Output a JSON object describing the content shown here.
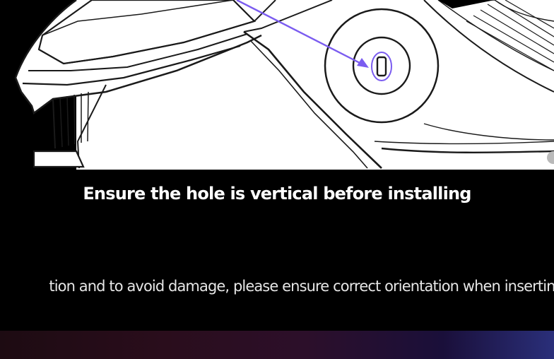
{
  "caption": "Ensure the hole is vertical before installing",
  "description": "tion and to avoid damage, please ensure correct orientation when inserting",
  "colors": {
    "background": "#000000",
    "line_art_stroke": "#1a1a1a",
    "line_art_fill": "#ffffff",
    "accent_arrow": "#7b5cf0",
    "caption_text": "#ffffff",
    "description_text": "#e6e6e6"
  },
  "icons": {
    "indicator_arrow": "arrow-icon",
    "slot_hole": "vertical-hole-icon"
  }
}
